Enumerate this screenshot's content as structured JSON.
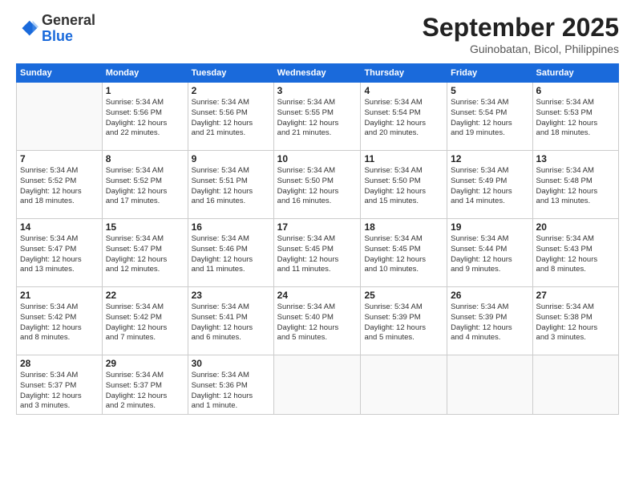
{
  "header": {
    "logo_general": "General",
    "logo_blue": "Blue",
    "month_title": "September 2025",
    "location": "Guinobatan, Bicol, Philippines"
  },
  "days_of_week": [
    "Sunday",
    "Monday",
    "Tuesday",
    "Wednesday",
    "Thursday",
    "Friday",
    "Saturday"
  ],
  "weeks": [
    [
      {
        "day": "",
        "info": ""
      },
      {
        "day": "1",
        "info": "Sunrise: 5:34 AM\nSunset: 5:56 PM\nDaylight: 12 hours\nand 22 minutes."
      },
      {
        "day": "2",
        "info": "Sunrise: 5:34 AM\nSunset: 5:56 PM\nDaylight: 12 hours\nand 21 minutes."
      },
      {
        "day": "3",
        "info": "Sunrise: 5:34 AM\nSunset: 5:55 PM\nDaylight: 12 hours\nand 21 minutes."
      },
      {
        "day": "4",
        "info": "Sunrise: 5:34 AM\nSunset: 5:54 PM\nDaylight: 12 hours\nand 20 minutes."
      },
      {
        "day": "5",
        "info": "Sunrise: 5:34 AM\nSunset: 5:54 PM\nDaylight: 12 hours\nand 19 minutes."
      },
      {
        "day": "6",
        "info": "Sunrise: 5:34 AM\nSunset: 5:53 PM\nDaylight: 12 hours\nand 18 minutes."
      }
    ],
    [
      {
        "day": "7",
        "info": "Sunrise: 5:34 AM\nSunset: 5:52 PM\nDaylight: 12 hours\nand 18 minutes."
      },
      {
        "day": "8",
        "info": "Sunrise: 5:34 AM\nSunset: 5:52 PM\nDaylight: 12 hours\nand 17 minutes."
      },
      {
        "day": "9",
        "info": "Sunrise: 5:34 AM\nSunset: 5:51 PM\nDaylight: 12 hours\nand 16 minutes."
      },
      {
        "day": "10",
        "info": "Sunrise: 5:34 AM\nSunset: 5:50 PM\nDaylight: 12 hours\nand 16 minutes."
      },
      {
        "day": "11",
        "info": "Sunrise: 5:34 AM\nSunset: 5:50 PM\nDaylight: 12 hours\nand 15 minutes."
      },
      {
        "day": "12",
        "info": "Sunrise: 5:34 AM\nSunset: 5:49 PM\nDaylight: 12 hours\nand 14 minutes."
      },
      {
        "day": "13",
        "info": "Sunrise: 5:34 AM\nSunset: 5:48 PM\nDaylight: 12 hours\nand 13 minutes."
      }
    ],
    [
      {
        "day": "14",
        "info": "Sunrise: 5:34 AM\nSunset: 5:47 PM\nDaylight: 12 hours\nand 13 minutes."
      },
      {
        "day": "15",
        "info": "Sunrise: 5:34 AM\nSunset: 5:47 PM\nDaylight: 12 hours\nand 12 minutes."
      },
      {
        "day": "16",
        "info": "Sunrise: 5:34 AM\nSunset: 5:46 PM\nDaylight: 12 hours\nand 11 minutes."
      },
      {
        "day": "17",
        "info": "Sunrise: 5:34 AM\nSunset: 5:45 PM\nDaylight: 12 hours\nand 11 minutes."
      },
      {
        "day": "18",
        "info": "Sunrise: 5:34 AM\nSunset: 5:45 PM\nDaylight: 12 hours\nand 10 minutes."
      },
      {
        "day": "19",
        "info": "Sunrise: 5:34 AM\nSunset: 5:44 PM\nDaylight: 12 hours\nand 9 minutes."
      },
      {
        "day": "20",
        "info": "Sunrise: 5:34 AM\nSunset: 5:43 PM\nDaylight: 12 hours\nand 8 minutes."
      }
    ],
    [
      {
        "day": "21",
        "info": "Sunrise: 5:34 AM\nSunset: 5:42 PM\nDaylight: 12 hours\nand 8 minutes."
      },
      {
        "day": "22",
        "info": "Sunrise: 5:34 AM\nSunset: 5:42 PM\nDaylight: 12 hours\nand 7 minutes."
      },
      {
        "day": "23",
        "info": "Sunrise: 5:34 AM\nSunset: 5:41 PM\nDaylight: 12 hours\nand 6 minutes."
      },
      {
        "day": "24",
        "info": "Sunrise: 5:34 AM\nSunset: 5:40 PM\nDaylight: 12 hours\nand 5 minutes."
      },
      {
        "day": "25",
        "info": "Sunrise: 5:34 AM\nSunset: 5:39 PM\nDaylight: 12 hours\nand 5 minutes."
      },
      {
        "day": "26",
        "info": "Sunrise: 5:34 AM\nSunset: 5:39 PM\nDaylight: 12 hours\nand 4 minutes."
      },
      {
        "day": "27",
        "info": "Sunrise: 5:34 AM\nSunset: 5:38 PM\nDaylight: 12 hours\nand 3 minutes."
      }
    ],
    [
      {
        "day": "28",
        "info": "Sunrise: 5:34 AM\nSunset: 5:37 PM\nDaylight: 12 hours\nand 3 minutes."
      },
      {
        "day": "29",
        "info": "Sunrise: 5:34 AM\nSunset: 5:37 PM\nDaylight: 12 hours\nand 2 minutes."
      },
      {
        "day": "30",
        "info": "Sunrise: 5:34 AM\nSunset: 5:36 PM\nDaylight: 12 hours\nand 1 minute."
      },
      {
        "day": "",
        "info": ""
      },
      {
        "day": "",
        "info": ""
      },
      {
        "day": "",
        "info": ""
      },
      {
        "day": "",
        "info": ""
      }
    ]
  ]
}
